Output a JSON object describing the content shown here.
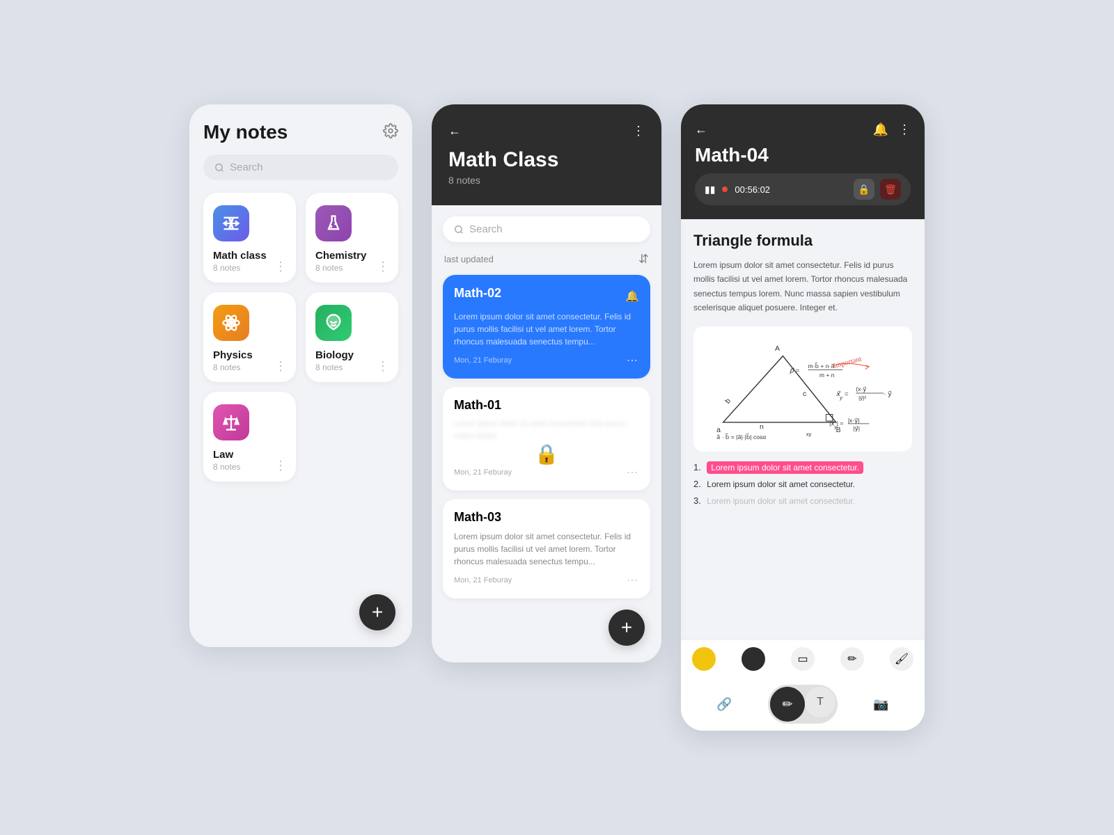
{
  "screen1": {
    "title": "My notes",
    "search_placeholder": "Search",
    "cards": [
      {
        "id": "math",
        "name": "Math class",
        "count": "8 notes",
        "icon_type": "math"
      },
      {
        "id": "chemistry",
        "name": "Chemistry",
        "count": "8 notes",
        "icon_type": "chemistry"
      },
      {
        "id": "physics",
        "name": "Physics",
        "count": "8 notes",
        "icon_type": "physics"
      },
      {
        "id": "biology",
        "name": "Biology",
        "count": "8 notes",
        "icon_type": "biology"
      },
      {
        "id": "law",
        "name": "Law",
        "count": "8 notes",
        "icon_type": "law"
      }
    ],
    "add_btn": "+"
  },
  "screen2": {
    "title": "Math Class",
    "subtitle": "8 notes",
    "search_placeholder": "Search",
    "last_updated": "last updated",
    "notes": [
      {
        "id": "math02",
        "title": "Math-02",
        "text": "Lorem ipsum dolor sit amet consectetur. Felis id purus mollis facilisi ut vel amet lorem. Tortor rhoncus malesuada senectus tempu...",
        "date": "Mon, 21 Feburay",
        "active": true,
        "locked": false
      },
      {
        "id": "math01",
        "title": "Math-01",
        "text": "Lorem ipsum dolor sit amet consectetur. Felis id purus mollis facilisi ut vel amet lorem.",
        "date": "Mon, 21 Feburay",
        "active": false,
        "locked": true
      },
      {
        "id": "math03",
        "title": "Math-03",
        "text": "Lorem ipsum dolor sit amet consectetur. Felis id purus mollis facilisi ut vel amet lorem. Tortor rhoncus malesuada senectus tempu...",
        "date": "Mon, 21 Feburay",
        "active": false,
        "locked": false
      }
    ],
    "add_btn": "+"
  },
  "screen3": {
    "title": "Math-04",
    "rec_time": "00:56:02",
    "section_title": "Triangle formula",
    "body_text": "Lorem ipsum dolor sit amet consectetur. Felis id purus mollis facilisi ut vel amet lorem. Tortor rhoncus malesuada senectus tempus lorem. Nunc massa sapien vestibulum scelerisque aliquet posuere. Integer et.",
    "list_items": [
      {
        "text": "Lorem ipsum dolor sit amet consectetur.",
        "highlighted": true
      },
      {
        "text": "Lorem ipsum dolor sit amet consectetur.",
        "highlighted": false
      },
      {
        "text": "Lorem ipsum dolor sit amet consectetur.",
        "highlighted": false
      }
    ],
    "tools": [
      "yellow",
      "black",
      "eraser",
      "pencil",
      "highlight"
    ],
    "actions": [
      "link",
      "pen",
      "text",
      "camera"
    ]
  }
}
